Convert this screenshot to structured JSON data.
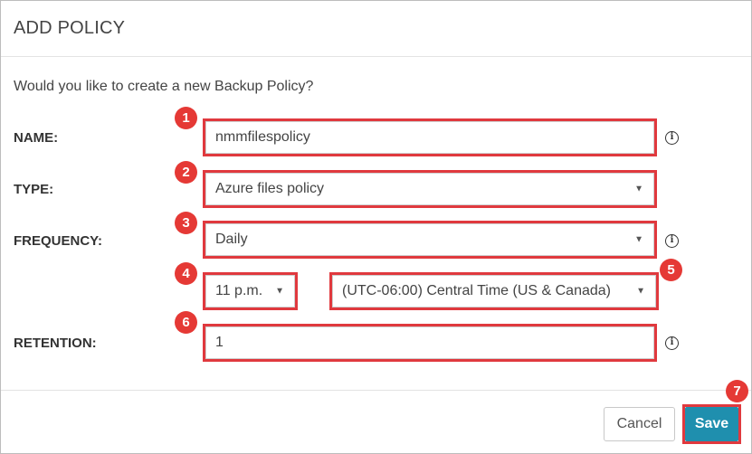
{
  "dialog": {
    "title": "ADD POLICY",
    "prompt": "Would you like to create a new Backup Policy?"
  },
  "form": {
    "name_label": "NAME:",
    "name_value": "nmmfilespolicy",
    "type_label": "TYPE:",
    "type_value": "Azure files policy",
    "frequency_label": "FREQUENCY:",
    "frequency_value": "Daily",
    "time_value": "11 p.m.",
    "timezone_value": "(UTC-06:00) Central Time (US & Canada)",
    "retention_label": "RETENTION:",
    "retention_value": "1"
  },
  "buttons": {
    "cancel": "Cancel",
    "save": "Save"
  },
  "annotations": {
    "badges": [
      "1",
      "2",
      "3",
      "4",
      "5",
      "6",
      "7"
    ],
    "highlight_color": "#e0393e"
  },
  "icons": {
    "info": "i",
    "caret": "▼"
  },
  "colors": {
    "save_button": "#1f8fae",
    "badge": "#e53935"
  }
}
